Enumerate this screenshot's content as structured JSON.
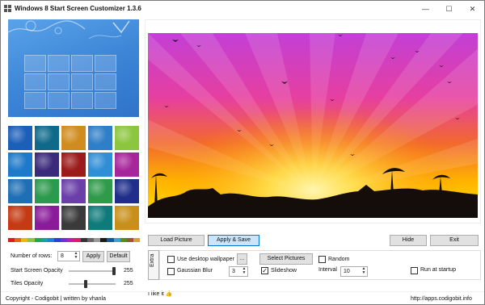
{
  "window": {
    "title": "Windows 8 Start Screen Customizer 1.3.6",
    "controls": {
      "minimize": "—",
      "maximize": "☐",
      "close": "✕"
    }
  },
  "left_panel": {
    "preview_color": "#3b84d6",
    "thumbnails": [
      "#1c5fb8",
      "#0f6a8a",
      "#d08c1e",
      "#2f7fc8",
      "#8cc63e",
      "#1d79c9",
      "#3a2a7a",
      "#9b1a1a",
      "#2f8ed6",
      "#a7259a",
      "#1f6fb5",
      "#2c9a4e",
      "#6a3fa8",
      "#2f9a4a",
      "#1f2e8a",
      "#c43a14",
      "#8a1c9a",
      "#3a3a3a",
      "#0f7a7a",
      "#c8901a"
    ],
    "palette": [
      "#e01a1a",
      "#e6650f",
      "#f0b60f",
      "#8cc63e",
      "#1ea84a",
      "#14a3a3",
      "#1a7fe0",
      "#2a3fd6",
      "#7a2ad6",
      "#c41ab0",
      "#e01a6a",
      "#333333",
      "#666666",
      "#999999",
      "#1a1a1a",
      "#0f5a9a",
      "#3aa0d6",
      "#5a8a1a",
      "#a0522d",
      "#d6a03a"
    ],
    "rows": {
      "label": "Number of rows:",
      "value": "8"
    },
    "apply_label": "Apply",
    "default_label": "Default",
    "opacity": {
      "label": "Start Screen Opacity",
      "value": "255",
      "level": 1.0
    },
    "tiles_opacity": {
      "label": "Tiles Opacity",
      "value": "255",
      "level": 0.36
    }
  },
  "main": {
    "load_picture": "Load Picture",
    "apply_save": "Apply & Save",
    "hide": "Hide",
    "exit": "Exit"
  },
  "extra": {
    "tab_label": "Extra",
    "use_desktop_wallpaper": {
      "label": "Use desktop wallpaper",
      "checked": false
    },
    "browse_label": "...",
    "select_pictures": "Select Pictures",
    "random": {
      "label": "Random",
      "checked": false
    },
    "gaussian_blur": {
      "label": "Gaussian Blur",
      "checked": false,
      "value": "3"
    },
    "slideshow": {
      "label": "Slideshow",
      "checked": true
    },
    "interval": {
      "label": "Interval",
      "value": "10"
    },
    "run_at_startup": {
      "label": "Run at startup",
      "checked": false
    }
  },
  "footer": {
    "like": "I like it",
    "like_icon": "thumbs-up-icon",
    "copyright": "Copyright - Codigobit | written by vhanla",
    "url": "http://apps.codigobit.info"
  }
}
